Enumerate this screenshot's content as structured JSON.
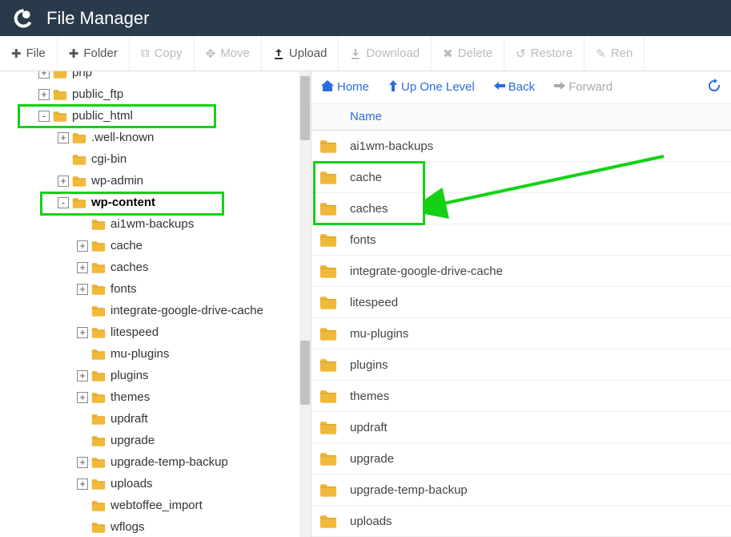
{
  "app": {
    "title": "File Manager"
  },
  "toolbar": {
    "file": "File",
    "folder": "Folder",
    "copy": "Copy",
    "move": "Move",
    "upload": "Upload",
    "download": "Download",
    "delete": "Delete",
    "restore": "Restore",
    "rename": "Ren"
  },
  "nav": {
    "home": "Home",
    "up": "Up One Level",
    "back": "Back",
    "forward": "Forward"
  },
  "list_header": {
    "name": "Name"
  },
  "list_items": [
    {
      "label": "ai1wm-backups"
    },
    {
      "label": "cache"
    },
    {
      "label": "caches"
    },
    {
      "label": "fonts"
    },
    {
      "label": "integrate-google-drive-cache"
    },
    {
      "label": "litespeed"
    },
    {
      "label": "mu-plugins"
    },
    {
      "label": "plugins"
    },
    {
      "label": "themes"
    },
    {
      "label": "updraft"
    },
    {
      "label": "upgrade"
    },
    {
      "label": "upgrade-temp-backup"
    },
    {
      "label": "uploads"
    }
  ],
  "tree": [
    {
      "depth": 1,
      "toggle": "+",
      "label": "php"
    },
    {
      "depth": 1,
      "toggle": "+",
      "label": "public_ftp"
    },
    {
      "depth": 1,
      "toggle": "-",
      "label": "public_html"
    },
    {
      "depth": 2,
      "toggle": "+",
      "label": ".well-known"
    },
    {
      "depth": 2,
      "toggle": "",
      "label": "cgi-bin"
    },
    {
      "depth": 2,
      "toggle": "+",
      "label": "wp-admin"
    },
    {
      "depth": 2,
      "toggle": "-",
      "label": "wp-content",
      "bold": true
    },
    {
      "depth": 3,
      "toggle": "",
      "label": "ai1wm-backups"
    },
    {
      "depth": 3,
      "toggle": "+",
      "label": "cache"
    },
    {
      "depth": 3,
      "toggle": "+",
      "label": "caches"
    },
    {
      "depth": 3,
      "toggle": "+",
      "label": "fonts"
    },
    {
      "depth": 3,
      "toggle": "",
      "label": "integrate-google-drive-cache"
    },
    {
      "depth": 3,
      "toggle": "+",
      "label": "litespeed"
    },
    {
      "depth": 3,
      "toggle": "",
      "label": "mu-plugins"
    },
    {
      "depth": 3,
      "toggle": "+",
      "label": "plugins"
    },
    {
      "depth": 3,
      "toggle": "+",
      "label": "themes"
    },
    {
      "depth": 3,
      "toggle": "",
      "label": "updraft"
    },
    {
      "depth": 3,
      "toggle": "",
      "label": "upgrade"
    },
    {
      "depth": 3,
      "toggle": "+",
      "label": "upgrade-temp-backup"
    },
    {
      "depth": 3,
      "toggle": "+",
      "label": "uploads"
    },
    {
      "depth": 3,
      "toggle": "",
      "label": "webtoffee_import"
    },
    {
      "depth": 3,
      "toggle": "",
      "label": "wflogs"
    }
  ],
  "colors": {
    "folder": "#f0b93a",
    "highlight": "#15d015",
    "link": "#2d6cdf"
  }
}
